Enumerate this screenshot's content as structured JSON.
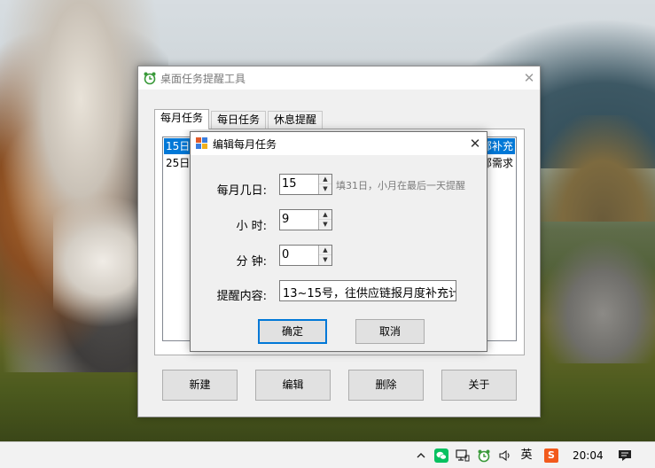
{
  "main_window": {
    "title": "桌面任务提醒工具",
    "tabs": [
      {
        "label": "每月任务",
        "active": true
      },
      {
        "label": "每日任务",
        "active": false
      },
      {
        "label": "休息提醒",
        "active": false
      }
    ],
    "list": [
      {
        "head": "15日",
        "tail": "部补充",
        "selected": true
      },
      {
        "head": "25日",
        "tail": "部需求",
        "selected": false
      }
    ],
    "buttons": {
      "new": "新建",
      "edit": "编辑",
      "delete": "删除",
      "about": "关于"
    }
  },
  "dialog": {
    "title": "编辑每月任务",
    "fields": {
      "day_label": "每月几日:",
      "day_value": "15",
      "day_hint": "填31日，小月在最后一天提醒",
      "hour_label": "小  时:",
      "hour_value": "9",
      "minute_label": "分  钟:",
      "minute_value": "0",
      "content_label": "提醒内容:",
      "content_value": "13~15号，往供应链报月度补充计"
    },
    "buttons": {
      "ok": "确定",
      "cancel": "取消"
    }
  },
  "taskbar": {
    "clock": "20:04",
    "tray_icons": [
      "chevron-up-icon",
      "wechat-icon",
      "network-icon",
      "task-reminder-icon",
      "volume-icon",
      "ime-icon",
      "sogou-icon",
      "notification-icon"
    ],
    "ime_label": "英",
    "sogou_label": "S"
  },
  "colors": {
    "accent": "#0078d7",
    "selection": "#0078d7",
    "window_bg": "#f0f0f0",
    "taskbar_bg": "#f2f2f2"
  }
}
